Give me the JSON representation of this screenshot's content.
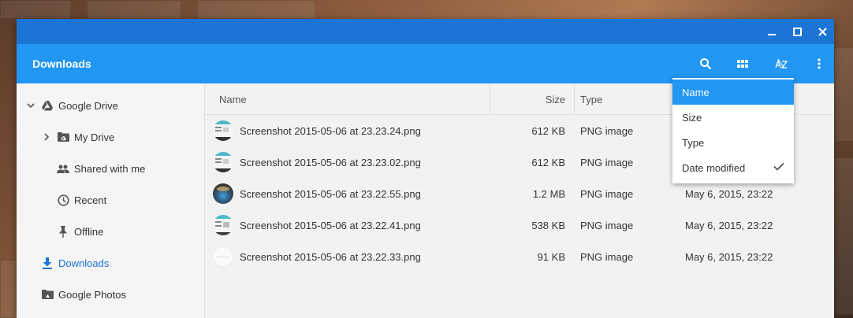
{
  "window": {
    "title": "Downloads"
  },
  "toolbar": {
    "icons": [
      "search-icon",
      "grid-view-icon",
      "sort-az-icon",
      "more-vert-icon"
    ]
  },
  "sidebar": {
    "items": [
      {
        "label": "Google Drive",
        "icon": "google-drive-icon",
        "expanded": true
      },
      {
        "label": "My Drive",
        "icon": "folder-drive-icon"
      },
      {
        "label": "Shared with me",
        "icon": "people-icon"
      },
      {
        "label": "Recent",
        "icon": "clock-icon"
      },
      {
        "label": "Offline",
        "icon": "pin-icon"
      },
      {
        "label": "Downloads",
        "icon": "download-icon",
        "active": true
      },
      {
        "label": "Google Photos",
        "icon": "folder-photos-icon"
      }
    ]
  },
  "table": {
    "columns": {
      "name": "Name",
      "size": "Size",
      "type": "Type"
    },
    "rows": [
      {
        "name": "Screenshot 2015-05-06 at 23.23.24.png",
        "size": "612 KB",
        "type": "PNG image",
        "date": ""
      },
      {
        "name": "Screenshot 2015-05-06 at 23.23.02.png",
        "size": "612 KB",
        "type": "PNG image",
        "date": ""
      },
      {
        "name": "Screenshot 2015-05-06 at 23.22.55.png",
        "size": "1.2 MB",
        "type": "PNG image",
        "date": "May 6, 2015, 23:22"
      },
      {
        "name": "Screenshot 2015-05-06 at 23.22.41.png",
        "size": "538 KB",
        "type": "PNG image",
        "date": "May 6, 2015, 23:22"
      },
      {
        "name": "Screenshot 2015-05-06 at 23.22.33.png",
        "size": "91 KB",
        "type": "PNG image",
        "date": "May 6, 2015, 23:22"
      }
    ]
  },
  "sort_menu": {
    "items": [
      {
        "label": "Name",
        "highlighted": true
      },
      {
        "label": "Size"
      },
      {
        "label": "Type"
      },
      {
        "label": "Date modified",
        "checked": true
      }
    ]
  },
  "colors": {
    "titlebar": "#1c74d4",
    "toolbar": "#2196f3",
    "active_nav": "#1c74d4"
  }
}
